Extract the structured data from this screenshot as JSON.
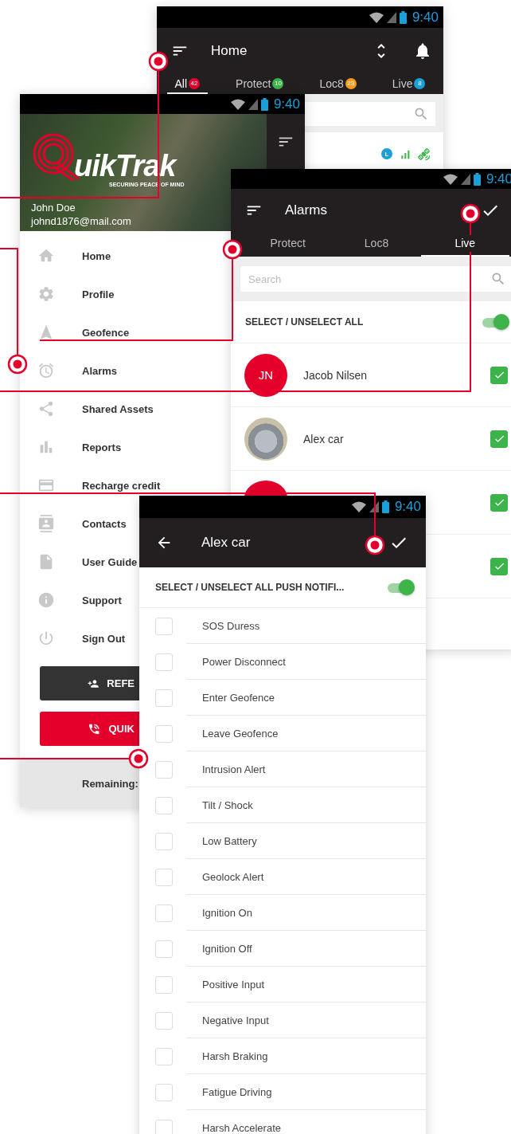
{
  "home_screen": {
    "status_time": "9:40",
    "title": "Home",
    "tabs": [
      {
        "label": "All",
        "count": "42",
        "color": "#e4002b",
        "selected": true
      },
      {
        "label": "Protect",
        "count": "10",
        "color": "#3cb44a",
        "selected": false
      },
      {
        "label": "Loc8",
        "count": "23",
        "color": "#f39a1e",
        "selected": false
      },
      {
        "label": "Live",
        "count": "8",
        "color": "#1a9fd9",
        "selected": false
      }
    ],
    "shield_letter": "L"
  },
  "drawer_screen": {
    "status_time": "9:40",
    "logo_text": "uikTrak",
    "tagline": "SECURING PEACE OF MIND",
    "user_name": "John Doe",
    "user_email": "johnd1876@mail.com",
    "menu_items": [
      {
        "label": "Home"
      },
      {
        "label": "Profile"
      },
      {
        "label": "Geofence"
      },
      {
        "label": "Alarms"
      },
      {
        "label": "Shared Assets"
      },
      {
        "label": "Reports"
      },
      {
        "label": "Recharge credit"
      },
      {
        "label": "Contacts"
      },
      {
        "label": "User Guide"
      },
      {
        "label": "Support"
      },
      {
        "label": "Sign Out"
      }
    ],
    "buttons": [
      {
        "label": "REFE",
        "kind": "dark"
      },
      {
        "label": "QUIK",
        "kind": "red"
      }
    ],
    "footer": "Remaining:"
  },
  "alarms_screen": {
    "status_time": "9:40",
    "title": "Alarms",
    "tabs": [
      {
        "label": "Protect",
        "selected": false
      },
      {
        "label": "Loc8",
        "selected": false
      },
      {
        "label": "Live",
        "selected": true
      }
    ],
    "search": {
      "placeholder": "Search"
    },
    "select_all": {
      "label": "SELECT / UNSELECT ALL",
      "on": true
    },
    "rows": [
      {
        "kind": "initials",
        "initials": "JN",
        "name": "Jacob Nilsen",
        "checked": true
      },
      {
        "kind": "photo",
        "name": "Alex car",
        "checked": true
      },
      {
        "kind": "covered_avatar",
        "checked": true
      },
      {
        "kind": "blank",
        "checked": true
      }
    ]
  },
  "alex_screen": {
    "status_time": "9:40",
    "title": "Alex car",
    "select_all": {
      "label": "SELECT / UNSELECT ALL PUSH NOTIFI...",
      "on": true
    },
    "items": [
      {
        "label": "SOS Duress",
        "checked": false
      },
      {
        "label": "Power Disconnect",
        "checked": false
      },
      {
        "label": "Enter Geofence",
        "checked": false
      },
      {
        "label": "Leave Geofence",
        "checked": false
      },
      {
        "label": "Intrusion Alert",
        "checked": false
      },
      {
        "label": "Tilt / Shock",
        "checked": false
      },
      {
        "label": "Low Battery",
        "checked": false
      },
      {
        "label": "Geolock Alert",
        "checked": false
      },
      {
        "label": "Ignition On",
        "checked": false
      },
      {
        "label": "Ignition Off",
        "checked": false
      },
      {
        "label": "Positive Input",
        "checked": false
      },
      {
        "label": "Negative Input",
        "checked": false
      },
      {
        "label": "Harsh Braking",
        "checked": false
      },
      {
        "label": "Fatigue Driving",
        "checked": false
      },
      {
        "label": "Harsh Accelerate",
        "checked": false
      }
    ]
  }
}
